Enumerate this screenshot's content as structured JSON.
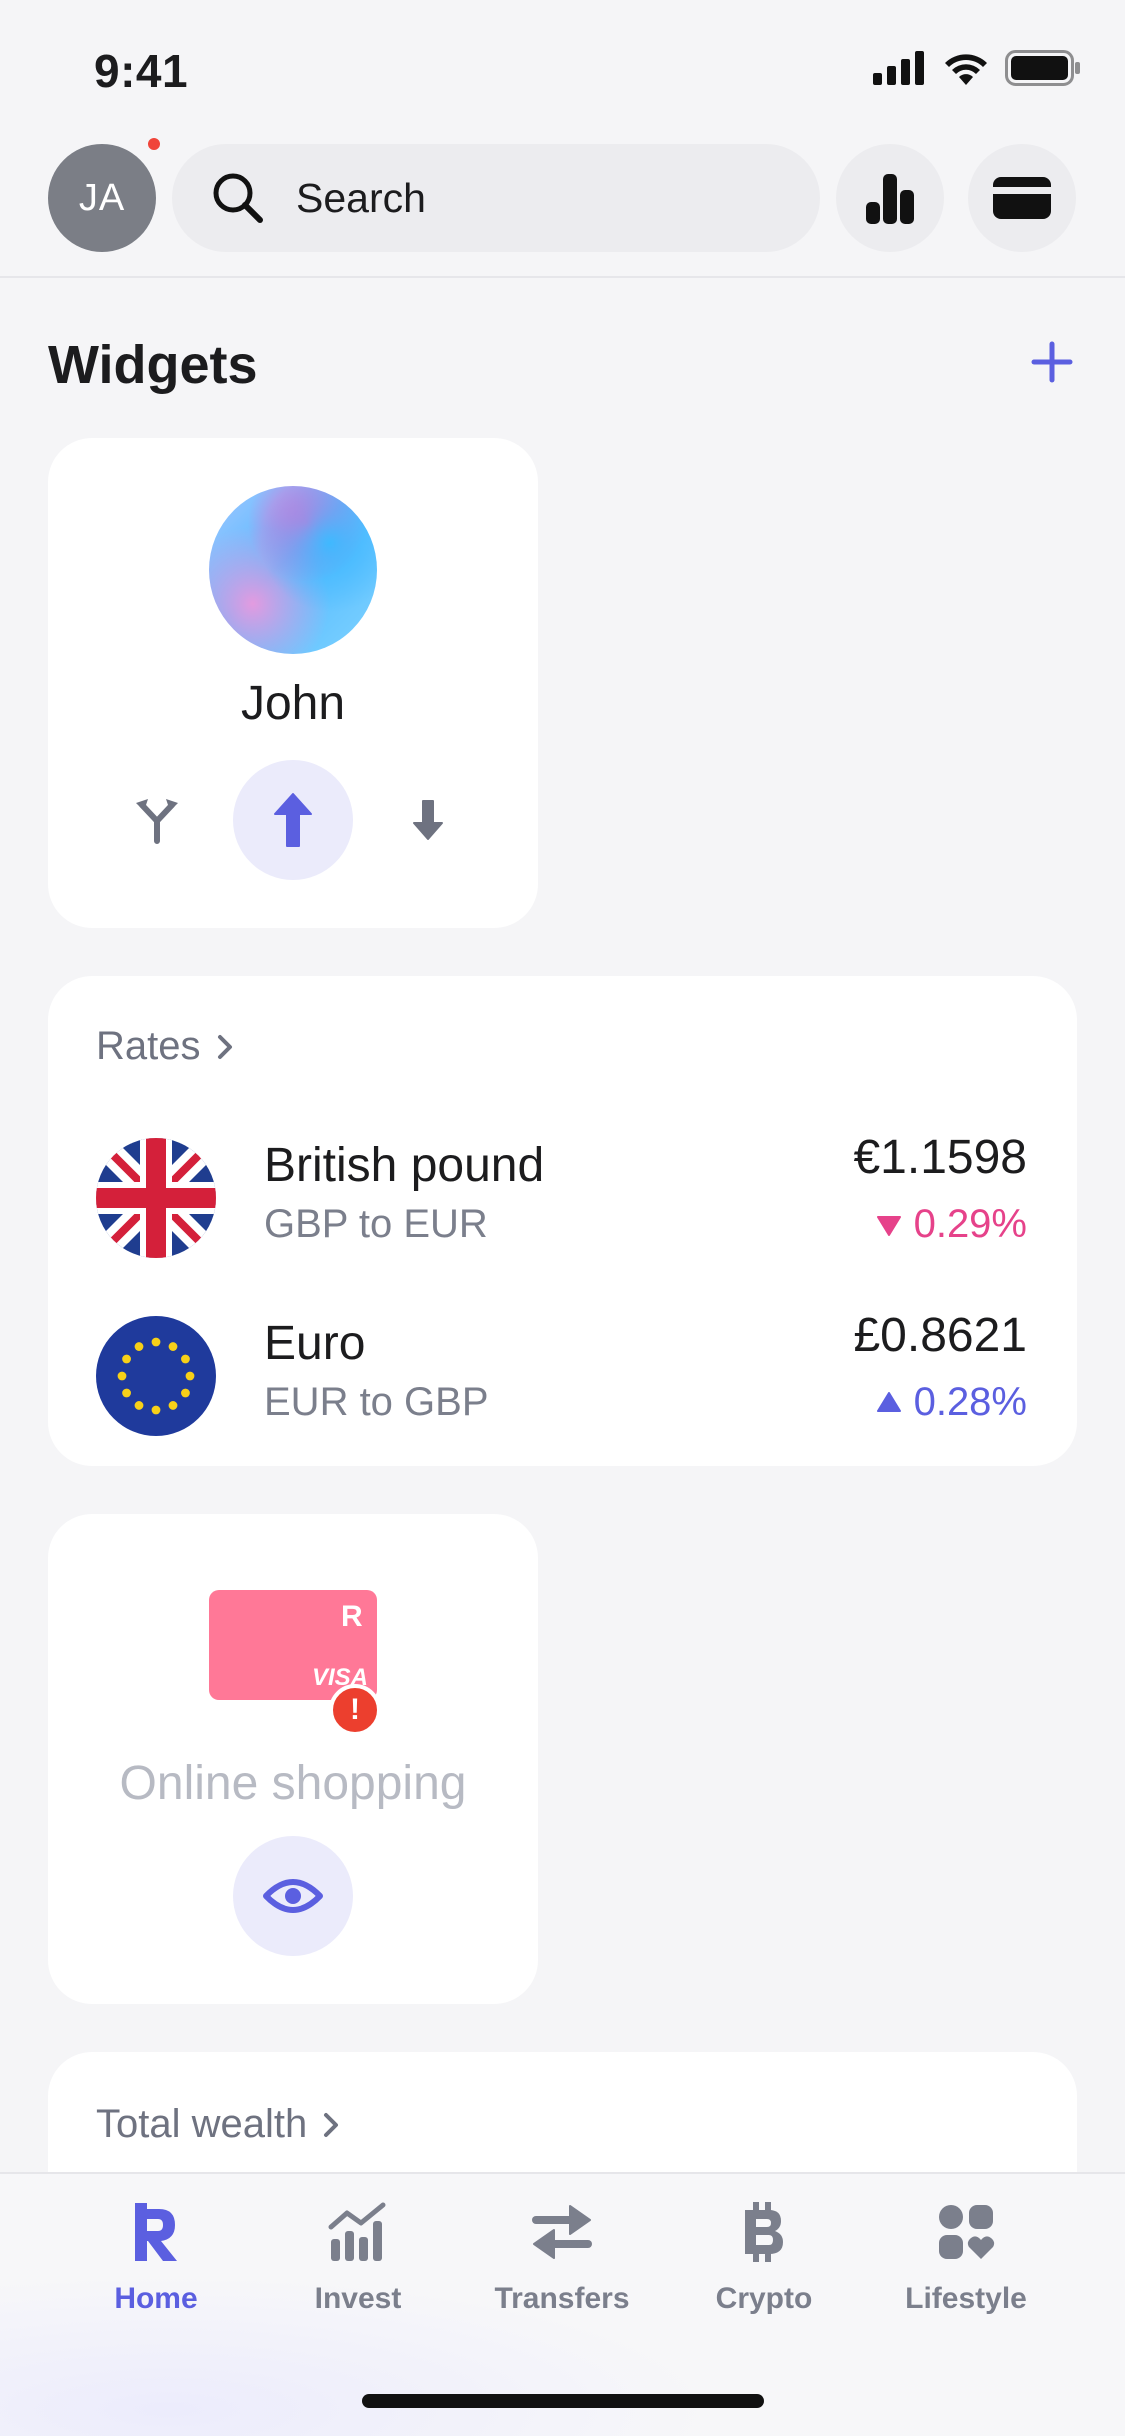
{
  "status_bar": {
    "time": "9:41"
  },
  "header": {
    "avatar_initials": "JA",
    "search_label": "Search"
  },
  "widgets": {
    "title": "Widgets",
    "account": {
      "name": "John"
    },
    "rates": {
      "title": "Rates",
      "items": [
        {
          "name": "British pound",
          "pair": "GBP to EUR",
          "value": "€1.1598",
          "change": "0.29%",
          "direction": "down",
          "color": "#e6428a"
        },
        {
          "name": "Euro",
          "pair": "EUR to GBP",
          "value": "£0.8621",
          "change": "0.28%",
          "direction": "up",
          "color": "#5b5fe0"
        }
      ]
    },
    "card": {
      "label": "Online shopping",
      "brand_mark": "R",
      "network": "VISA",
      "alert": "!"
    },
    "wealth": {
      "title": "Total wealth"
    }
  },
  "tabs": [
    {
      "label": "Home",
      "icon": "revolut-r-icon",
      "active": true
    },
    {
      "label": "Invest",
      "icon": "invest-chart-icon",
      "active": false
    },
    {
      "label": "Transfers",
      "icon": "transfer-arrows-icon",
      "active": false
    },
    {
      "label": "Crypto",
      "icon": "bitcoin-icon",
      "active": false
    },
    {
      "label": "Lifestyle",
      "icon": "lifestyle-icon",
      "active": false
    }
  ],
  "colors": {
    "accent": "#5b5fe0",
    "negative": "#e6428a",
    "background": "#f5f5f7",
    "card_pink": "#ff7897"
  }
}
